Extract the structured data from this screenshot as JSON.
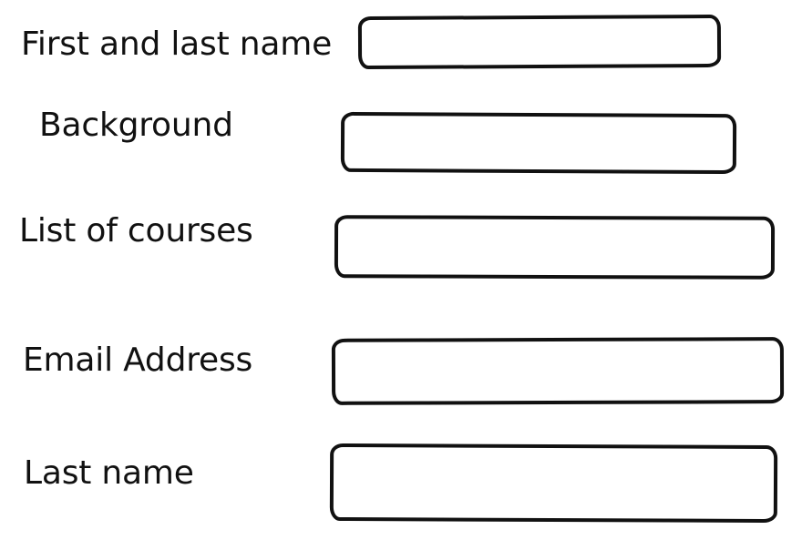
{
  "form": {
    "fields": [
      {
        "label": "First and last name",
        "value": "",
        "placeholder": ""
      },
      {
        "label": "Background",
        "value": "",
        "placeholder": ""
      },
      {
        "label": "List of courses",
        "value": "",
        "placeholder": ""
      },
      {
        "label": "Email Address",
        "value": "",
        "placeholder": ""
      },
      {
        "label": "Last name",
        "value": "",
        "placeholder": ""
      }
    ]
  },
  "colors": {
    "ink": "#111111",
    "background": "#ffffff"
  }
}
